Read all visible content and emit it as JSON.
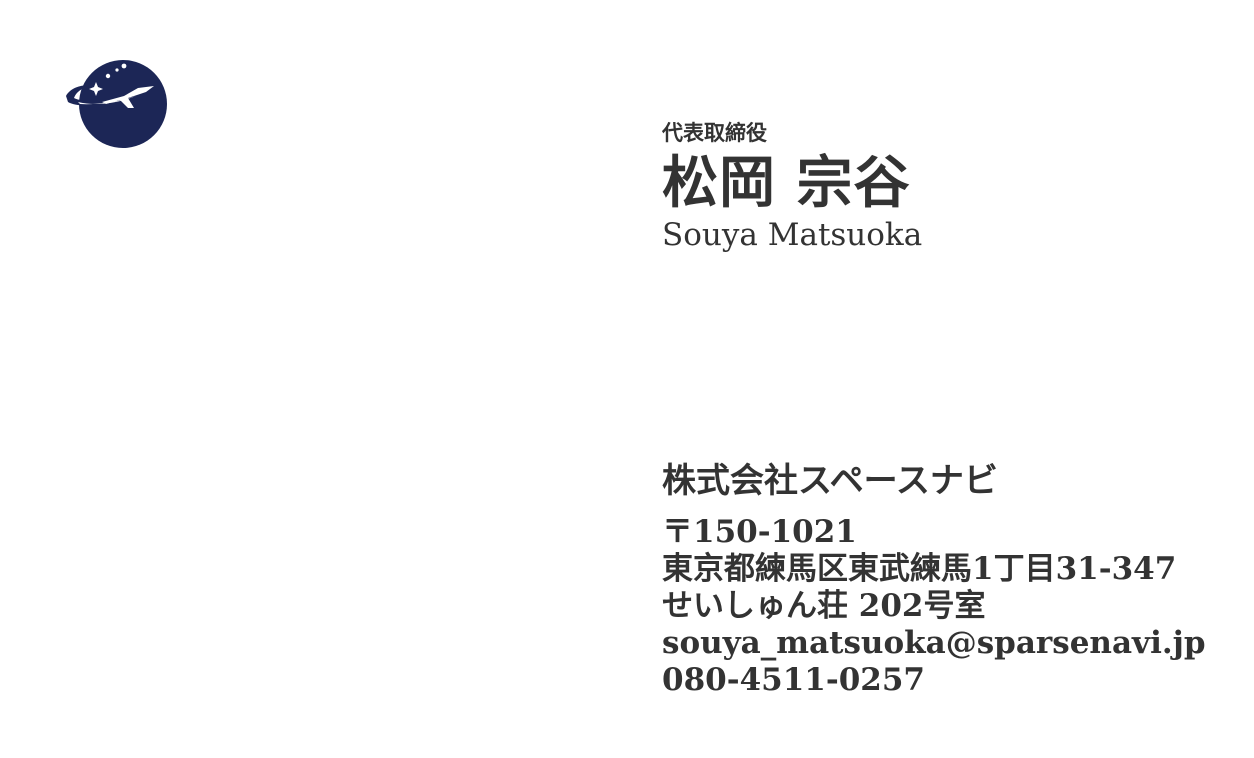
{
  "colors": {
    "text": "#333333",
    "logo_navy": "#1c2656",
    "background": "#ffffff"
  },
  "logo": {
    "icon": "space-airplane-logo-icon"
  },
  "person": {
    "role": "代表取締役",
    "name_ja": "松岡 宗谷",
    "name_en": "Souya Matsuoka"
  },
  "company": {
    "name": "株式会社スペースナビ",
    "postal": "〒150-1021",
    "address_line1": "東京都練馬区東武練馬1丁目31-347",
    "address_line2": "せいしゅん荘 202号室",
    "email": "souya_matsuoka@sparsenavi.jp",
    "phone": "080-4511-0257"
  }
}
